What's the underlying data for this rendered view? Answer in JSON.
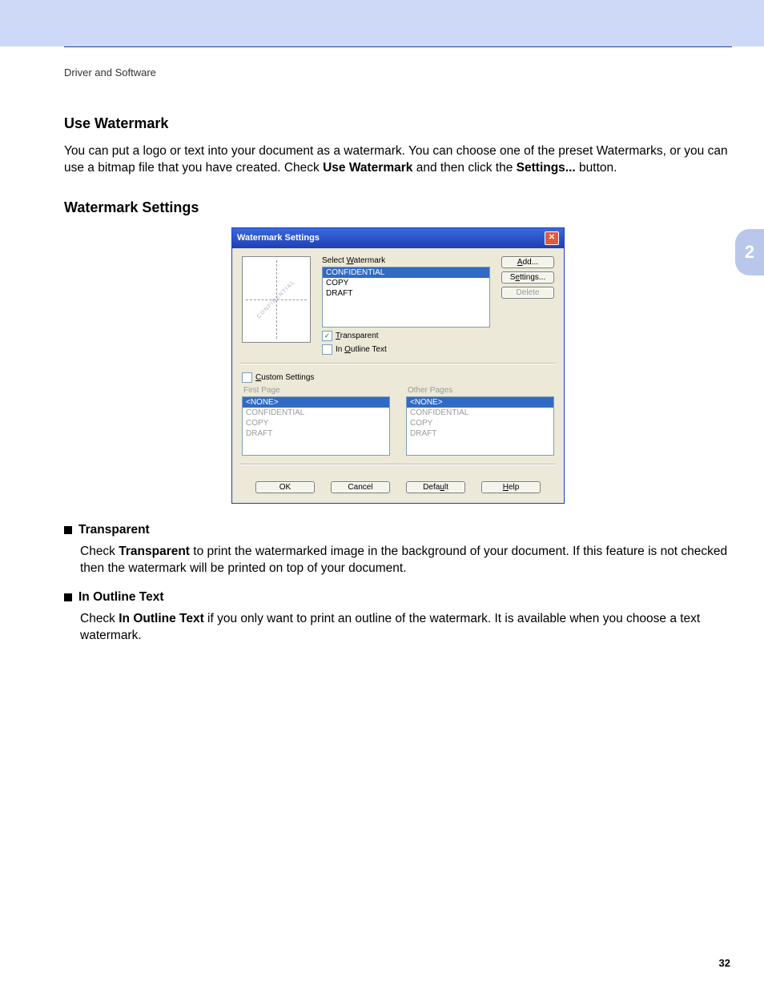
{
  "header": {
    "section_path": "Driver and Software"
  },
  "side_tab": "2",
  "sections": {
    "use_watermark": {
      "title": "Use Watermark",
      "para_before": "You can put a logo or text into your document as a watermark. You can choose one of the preset Watermarks, or you can use a bitmap file that you have created. Check ",
      "bold1": "Use Watermark",
      "mid": " and then click the ",
      "bold2": "Settings...",
      "after": " button."
    },
    "watermark_settings": {
      "title": "Watermark Settings"
    }
  },
  "dialog": {
    "title": "Watermark Settings",
    "close": "✕",
    "preview_text": "CONFIDENTIAL",
    "select_label_pre": "Select ",
    "select_label_u": "W",
    "select_label_post": "atermark",
    "list_items": [
      "CONFIDENTIAL",
      "COPY",
      "DRAFT"
    ],
    "selected_index": 0,
    "buttons": {
      "add_u": "A",
      "add_post": "dd...",
      "settings_pre": "S",
      "settings_u": "e",
      "settings_post": "ttings...",
      "delete_pre": "D",
      "delete_u": "e",
      "delete_post": "lete"
    },
    "chk_transparent_u": "T",
    "chk_transparent_post": "ransparent",
    "chk_outline_pre": "In ",
    "chk_outline_u": "O",
    "chk_outline_post": "utline Text",
    "chk_custom_u": "C",
    "chk_custom_post": "ustom Settings",
    "col_first": "First Page",
    "col_other": "Other Pages",
    "custom_items": [
      "<NONE>",
      "CONFIDENTIAL",
      "COPY",
      "DRAFT"
    ],
    "footer": {
      "ok": "OK",
      "cancel": "Cancel",
      "default_pre": "Defa",
      "default_u": "u",
      "default_post": "lt",
      "help_u": "H",
      "help_post": "elp"
    }
  },
  "bullets": {
    "transparent": {
      "title": "Transparent",
      "body_pre": "Check ",
      "body_bold": "Transparent",
      "body_post": " to print the watermarked image in the background of your document. If this feature is not checked then the watermark will be printed on top of your document."
    },
    "outline": {
      "title": "In Outline Text",
      "body_pre": "Check ",
      "body_bold": "In Outline Text",
      "body_post": " if you only want to print an outline of the watermark. It is available when you choose a text watermark."
    }
  },
  "page_number": "32"
}
